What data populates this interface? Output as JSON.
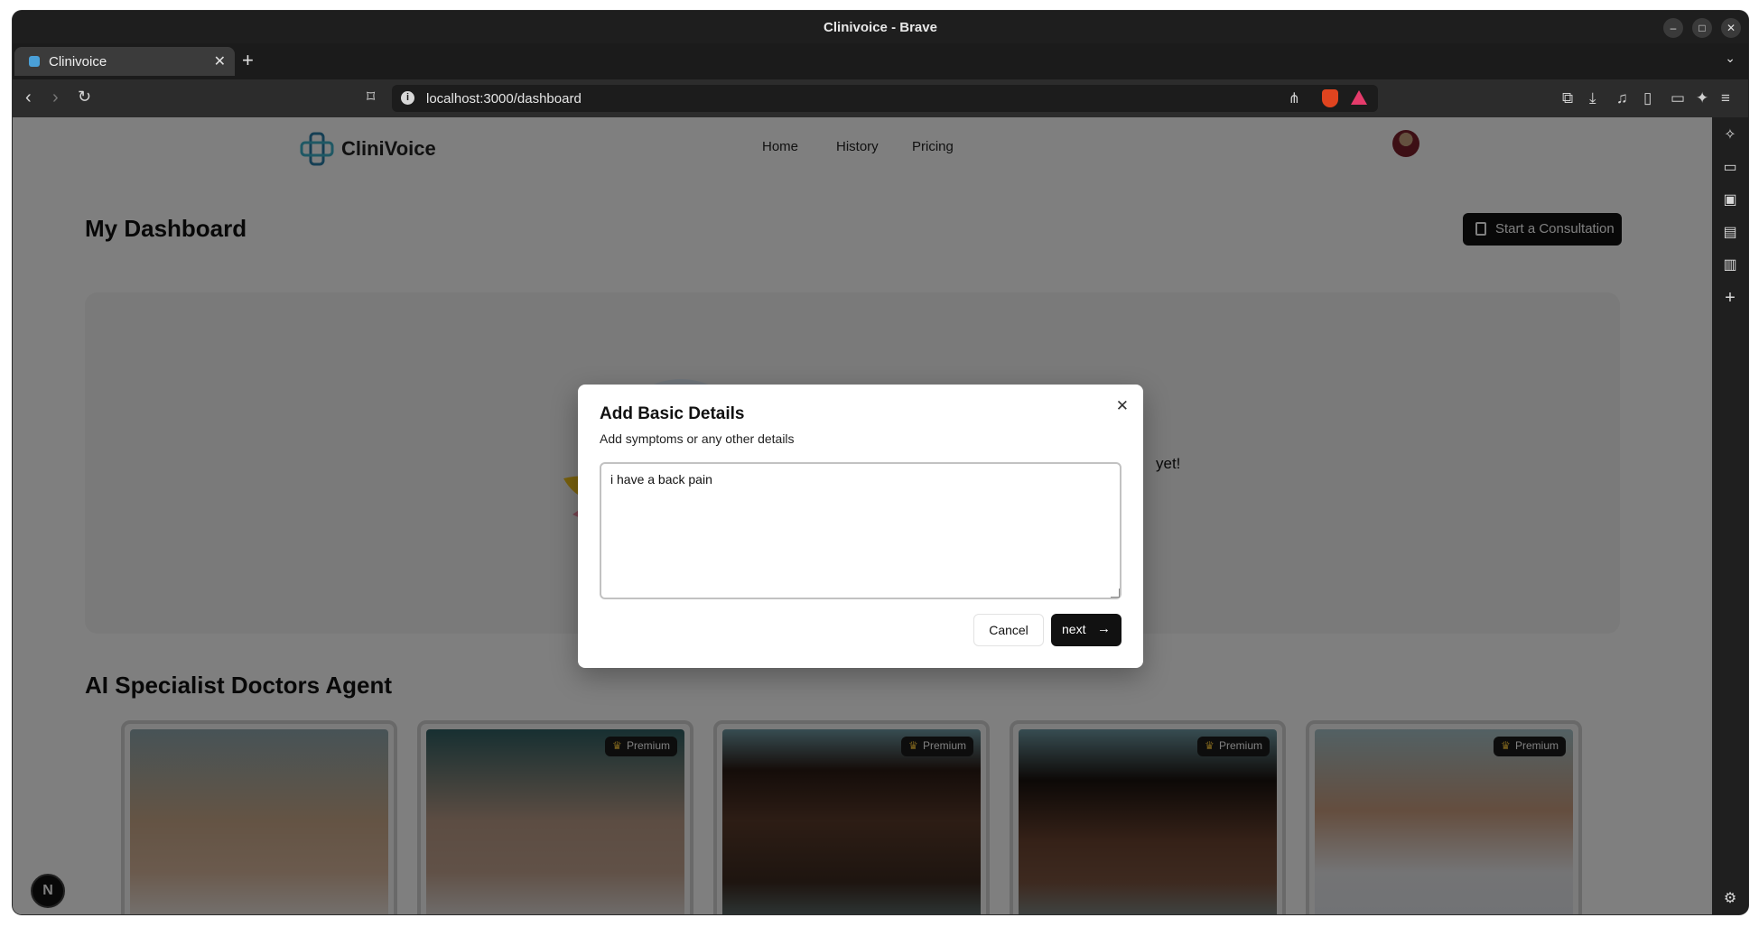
{
  "window": {
    "title": "Clinivoice - Brave"
  },
  "browser": {
    "tab_title": "Clinivoice",
    "url": "localhost:3000/dashboard"
  },
  "app": {
    "brand": "CliniVoice",
    "nav": [
      "Home",
      "History",
      "Pricing"
    ]
  },
  "dashboard": {
    "title": "My Dashboard",
    "start_button": "Start a Consultation",
    "empty_text": "yet!"
  },
  "specialists": {
    "title": "AI Specialist Doctors Agent",
    "badge": "Premium",
    "cards": [
      {
        "premium": false
      },
      {
        "premium": true
      },
      {
        "premium": true
      },
      {
        "premium": true
      },
      {
        "premium": true
      }
    ]
  },
  "modal": {
    "title": "Add Basic Details",
    "description": "Add symptoms or any other details",
    "textarea_value": "i have a back pain",
    "cancel_label": "Cancel",
    "next_label": "next"
  },
  "colors": {
    "primary": "#111111",
    "premium_crown": "#f6c43a",
    "overlay": "rgba(0,0,0,0.5)"
  }
}
